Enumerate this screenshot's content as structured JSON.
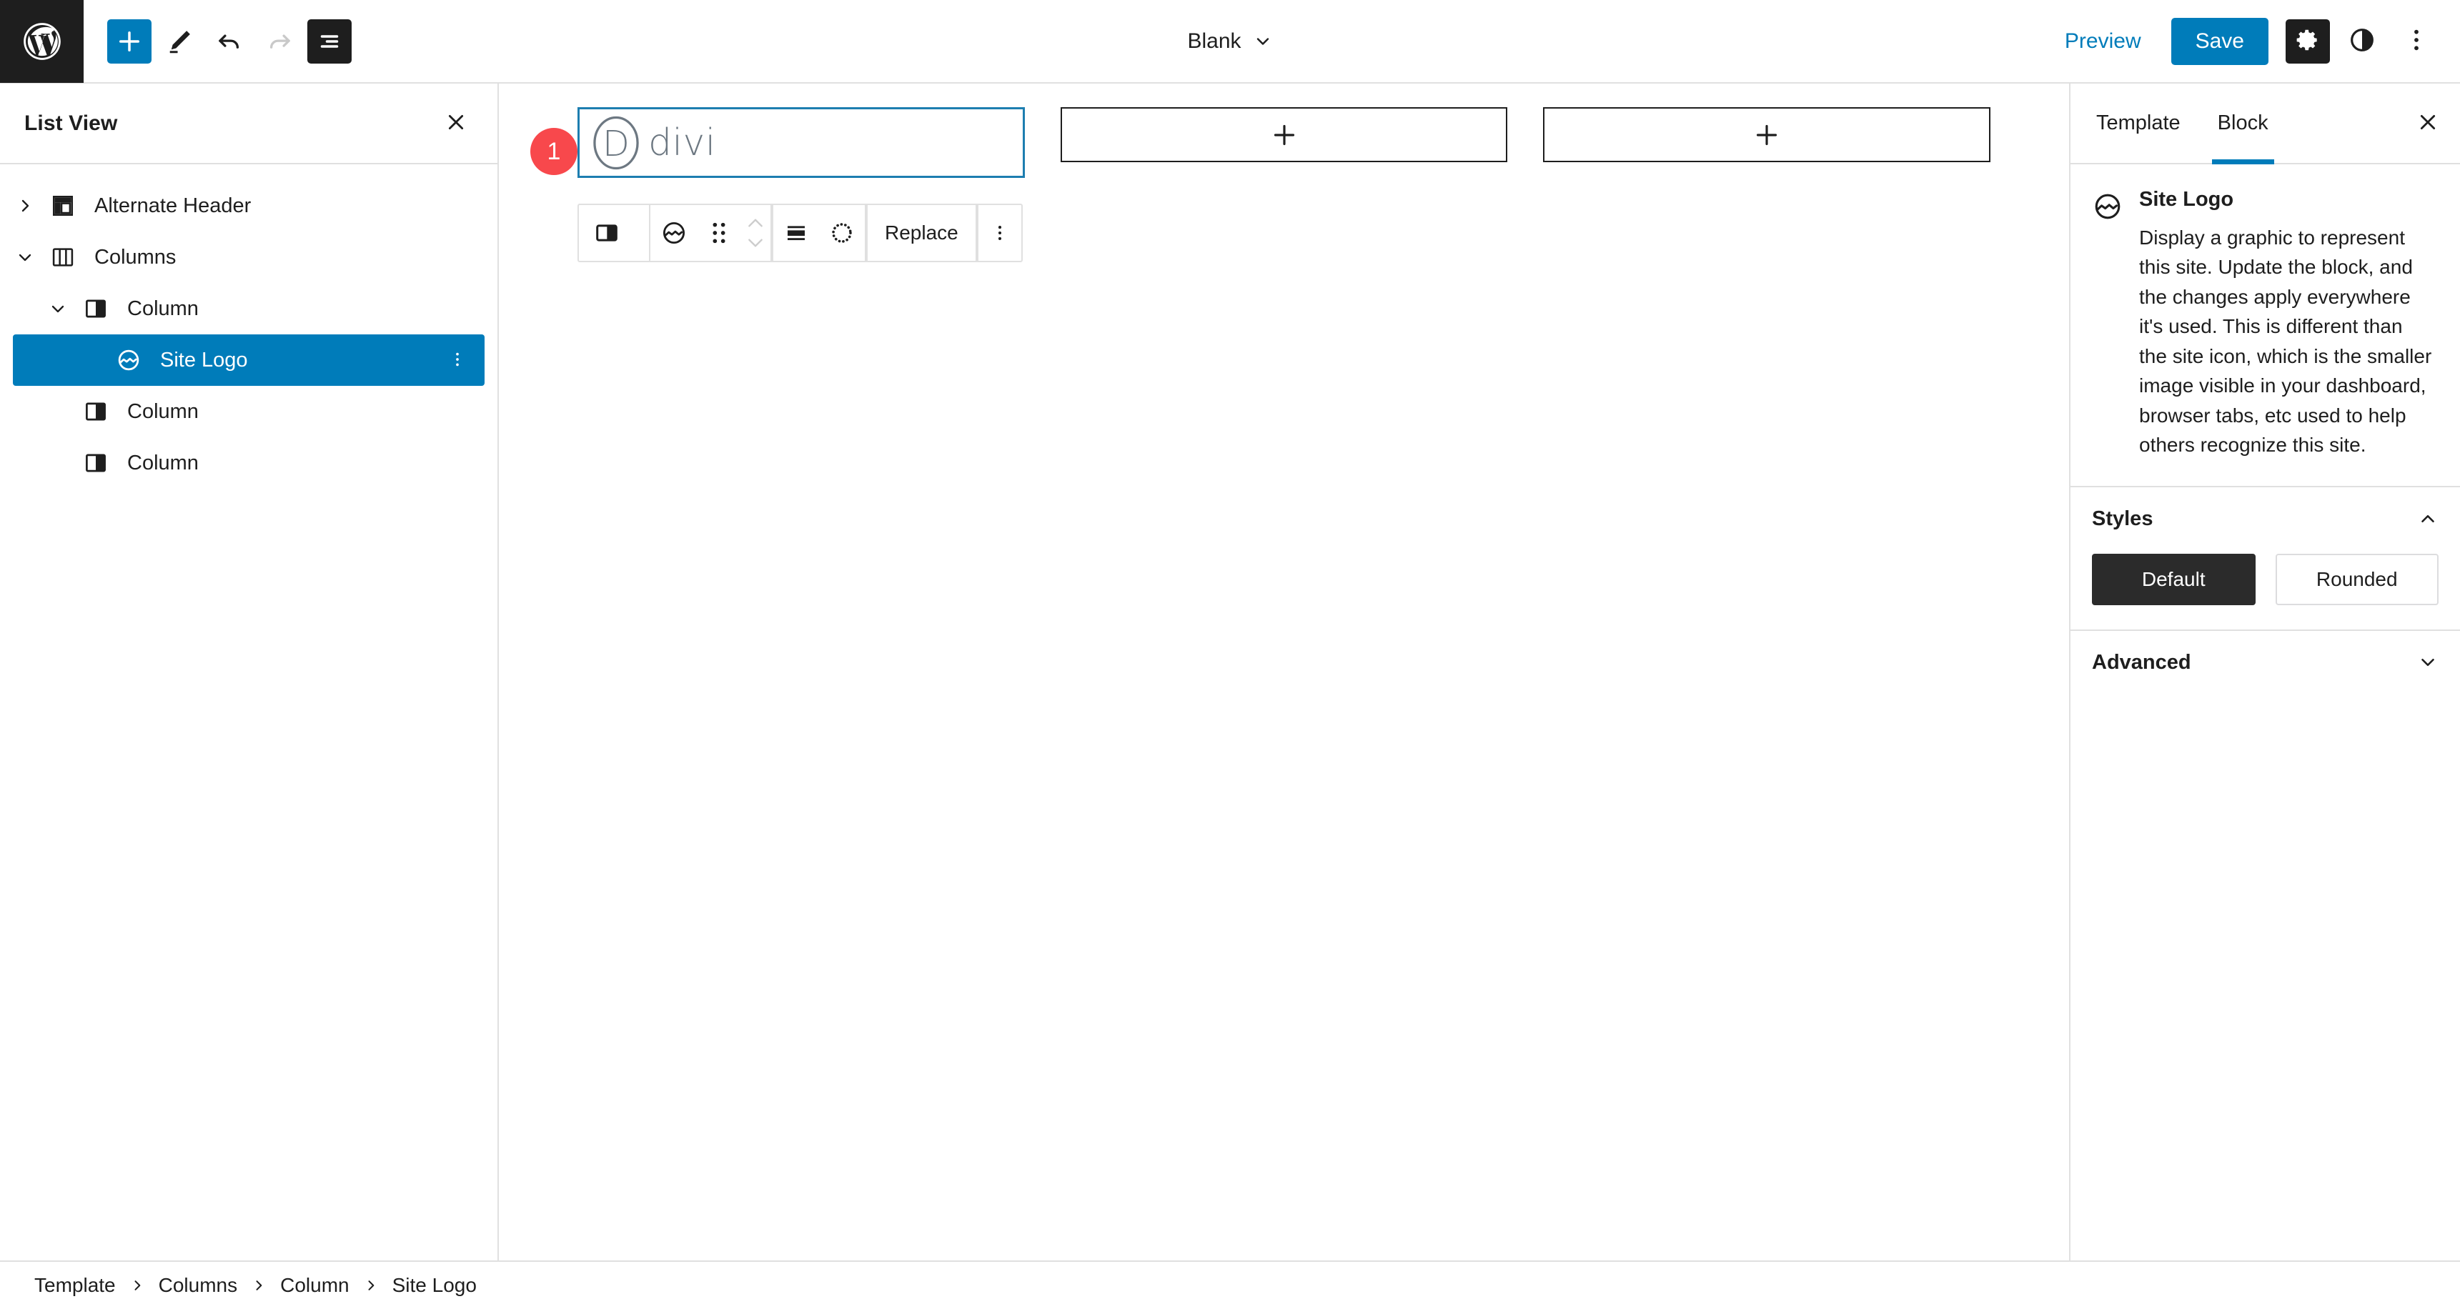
{
  "topbar": {
    "wp_logo_icon": "wordpress-logo-icon",
    "add_block_label": "+",
    "add_block_icon": "plus-icon",
    "tools_icon": "pencil-edit-icon",
    "undo_icon": "undo-icon",
    "redo_icon": "redo-icon",
    "listview_icon": "list-view-icon",
    "document_title": "Blank",
    "document_chevron_icon": "chevron-down-icon",
    "preview_label": "Preview",
    "save_label": "Save",
    "settings_icon": "gear-icon",
    "styles_icon": "contrast-half-circle-icon",
    "options_icon": "three-dots-vertical-icon"
  },
  "list_view": {
    "title": "List View",
    "close_icon": "close-x-icon",
    "items": [
      {
        "label": "Alternate Header",
        "icon": "template-part-icon",
        "depth": 0,
        "expanded": false,
        "chevron": "chevron-right-icon",
        "selected": false
      },
      {
        "label": "Columns",
        "icon": "columns-icon",
        "depth": 0,
        "expanded": true,
        "chevron": "chevron-down-icon",
        "selected": false
      },
      {
        "label": "Column",
        "icon": "column-icon",
        "depth": 1,
        "expanded": true,
        "chevron": "chevron-down-icon",
        "selected": false
      },
      {
        "label": "Site Logo",
        "icon": "site-logo-icon",
        "depth": 2,
        "expanded": false,
        "chevron": "",
        "selected": true,
        "more_icon": "three-dots-vertical-icon"
      },
      {
        "label": "Column",
        "icon": "column-icon",
        "depth": 1,
        "expanded": false,
        "chevron": "",
        "selected": false
      },
      {
        "label": "Column",
        "icon": "column-icon",
        "depth": 1,
        "expanded": false,
        "chevron": "",
        "selected": false
      }
    ]
  },
  "canvas": {
    "marker_badge": "1",
    "marker_color": "#f8484c",
    "selection_color": "#1d7eb0",
    "logo": {
      "mark_letter": "D",
      "wordmark": "divi"
    },
    "empty_columns": [
      {
        "add_icon": "plus-icon"
      },
      {
        "add_icon": "plus-icon"
      }
    ]
  },
  "block_toolbar": {
    "parent_selector_icon": "column-icon",
    "block_type_icon": "site-logo-icon",
    "drag_handle_icon": "drag-dots-icon",
    "move_up_icon": "chevron-up-icon",
    "move_down_icon": "chevron-down-icon",
    "align_icon": "align-center-icon",
    "duotone_icon": "dotted-circle-icon",
    "replace_label": "Replace",
    "more_options_icon": "three-dots-vertical-icon"
  },
  "inspector": {
    "tabs": [
      {
        "label": "Template",
        "active": false
      },
      {
        "label": "Block",
        "active": true
      }
    ],
    "close_icon": "close-x-icon",
    "block_card": {
      "icon": "site-logo-icon",
      "title": "Site Logo",
      "description": "Display a graphic to represent this site. Update the block, and the changes apply everywhere it's used. This is different than the site icon, which is the smaller image visible in your dashboard, browser tabs, etc used to help others recognize this site."
    },
    "panels": [
      {
        "title": "Styles",
        "expanded": true,
        "chevron_icon": "chevron-up-icon",
        "variations": [
          {
            "label": "Default",
            "selected": true
          },
          {
            "label": "Rounded",
            "selected": false
          }
        ]
      },
      {
        "title": "Advanced",
        "expanded": false,
        "chevron_icon": "chevron-down-icon"
      }
    ]
  },
  "footer": {
    "breadcrumbs": [
      "Template",
      "Columns",
      "Column",
      "Site Logo"
    ],
    "separator_icon": "chevron-right-icon"
  },
  "colors": {
    "accent_blue": "#007cba",
    "selection_blue": "#1d7eb0",
    "marker_red": "#f8484c",
    "dark": "#1e1e1e",
    "border_gray": "#e0e0e0"
  }
}
